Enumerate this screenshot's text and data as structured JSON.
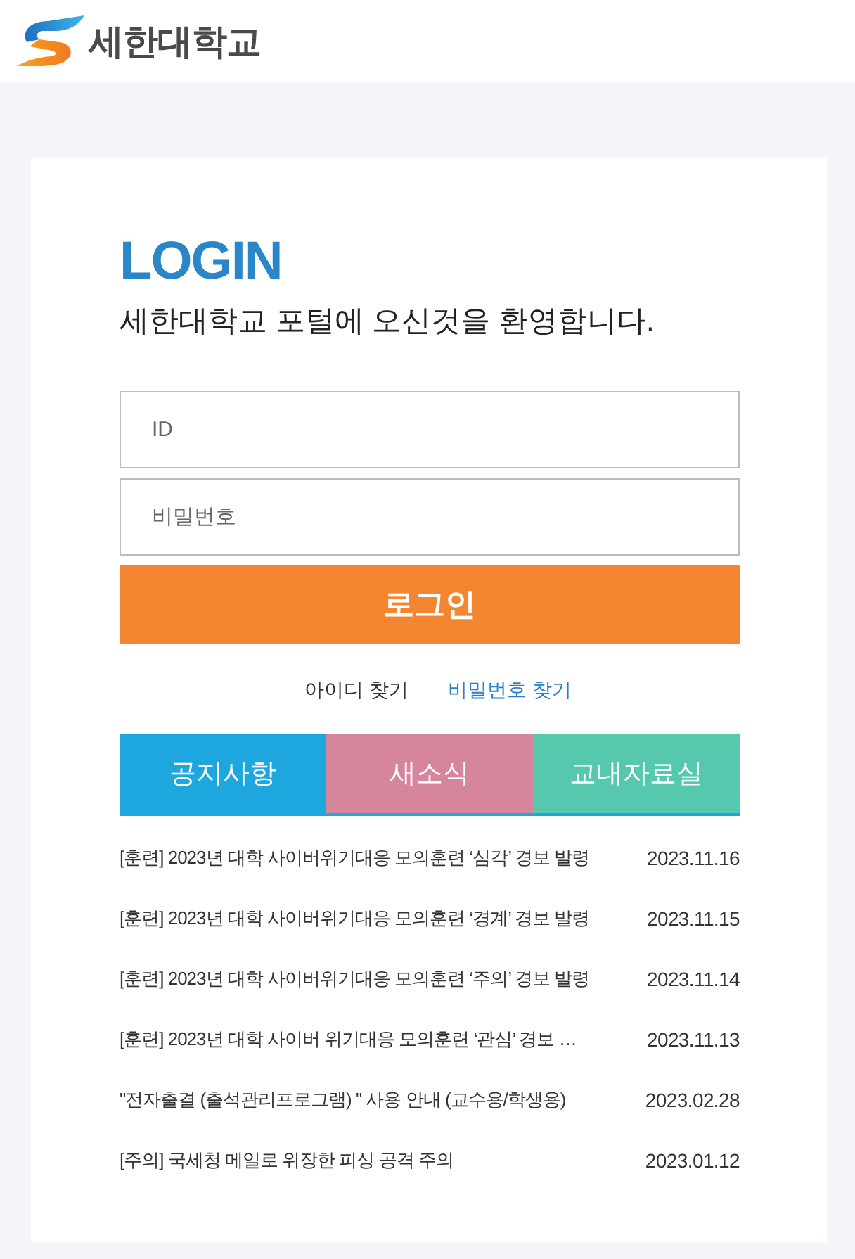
{
  "header": {
    "logo_text": "세한대학교"
  },
  "login": {
    "title": "LOGIN",
    "subtitle": "세한대학교 포털에 오신것을 환영합니다.",
    "id_field": {
      "placeholder": "ID"
    },
    "password_field": {
      "placeholder": "비밀번호"
    },
    "submit": "로그인",
    "links": [
      {
        "label": "아이디 찾기",
        "color": "#333333"
      },
      {
        "label": "비밀번호 찾기",
        "color": "#2a7ec5"
      }
    ]
  },
  "tabs": [
    {
      "label": "공지사항",
      "color": "#1ea7df",
      "selected": true
    },
    {
      "label": "새소식",
      "color": "#d5869c",
      "selected": false
    },
    {
      "label": "교내자료실",
      "color": "#55c8ae",
      "selected": false
    }
  ],
  "notices": [
    {
      "title": "[훈련] 2023년 대학 사이버위기대응 모의훈련 ‘심각’ 경보 발령",
      "date": "2023.11.16"
    },
    {
      "title": "[훈련] 2023년 대학 사이버위기대응 모의훈련 ‘경계’ 경보 발령",
      "date": "2023.11.15"
    },
    {
      "title": "[훈련] 2023년 대학 사이버위기대응 모의훈련 ‘주의’ 경보 발령",
      "date": "2023.11.14"
    },
    {
      "title": "[훈련] 2023년 대학 사이버 위기대응 모의훈련 ‘관심’ 경보 …",
      "date": "2023.11.13"
    },
    {
      "title": "\"전자출결 (출석관리프로그램) \" 사용 안내 (교수용/학생용)",
      "date": "2023.02.28"
    },
    {
      "title": "[주의] 국세청 메일로 위장한 피싱 공격 주의",
      "date": "2023.01.12"
    }
  ]
}
